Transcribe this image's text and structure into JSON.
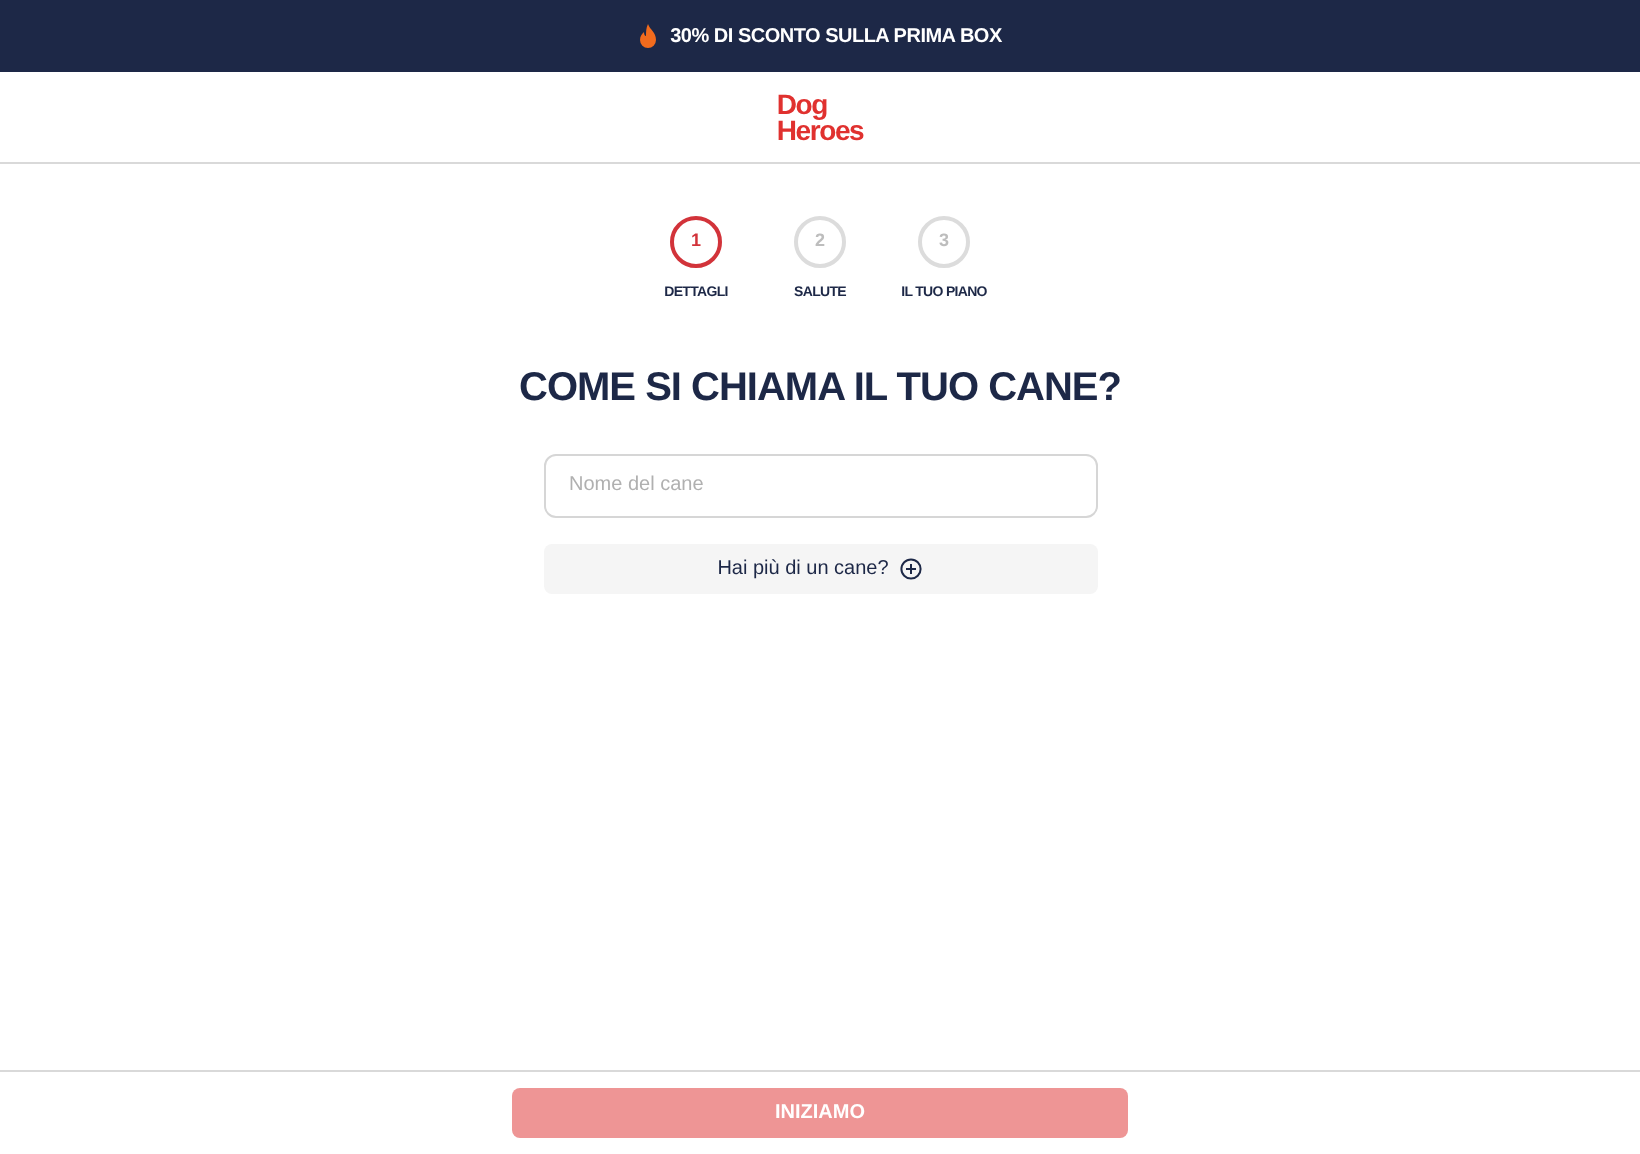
{
  "promo_banner": {
    "text": "30% DI SCONTO SULLA PRIMA BOX"
  },
  "logo": {
    "lines": [
      "Dog",
      "Heroes"
    ]
  },
  "steps": [
    {
      "number": "1",
      "label": "DETTAGLI",
      "selected": true
    },
    {
      "number": "2",
      "label": "SALUTE",
      "selected": false
    },
    {
      "number": "3",
      "label": "IL TUO PIANO",
      "selected": false
    }
  ],
  "heading": "COME SI CHIAMA IL TUO CANE?",
  "name_field": {
    "placeholder": "Nome del cane"
  },
  "add_dog_button": {
    "label": "Hai più di un cane?"
  },
  "start_button": {
    "label": "INIZIAMO",
    "disabled": true
  }
}
